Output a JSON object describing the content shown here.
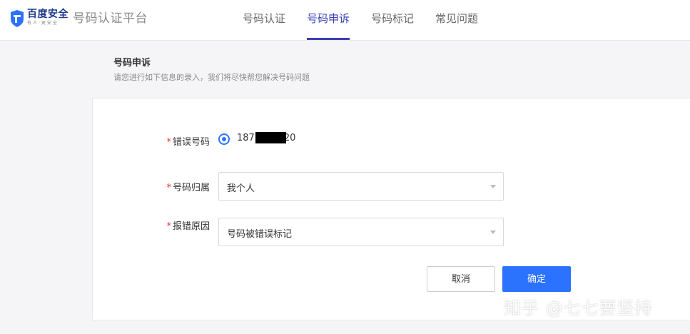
{
  "header": {
    "logo_name": "百度安全",
    "logo_sub": "有人·更安全",
    "platform_name": "号码认证平台",
    "nav": [
      {
        "label": "号码认证"
      },
      {
        "label": "号码申诉"
      },
      {
        "label": "号码标记"
      },
      {
        "label": "常见问题"
      }
    ]
  },
  "page": {
    "title": "号码申诉",
    "subtitle": "请您进行如下信息的录入，我们将尽快帮您解决号码问题"
  },
  "form": {
    "required_mark": "*",
    "wrong_number_label": "错误号码",
    "phone_prefix": "187",
    "phone_suffix": "20",
    "ownership_label": "号码归属",
    "ownership_value": "我个人",
    "reason_label": "报错原因",
    "reason_value": "号码被错误标记",
    "cancel_label": "取消",
    "confirm_label": "确定"
  },
  "watermark": "知乎 @七七要坚持",
  "colors": {
    "accent": "#3b3fb6",
    "primary_button": "#2b72ff",
    "required": "#e53935"
  }
}
